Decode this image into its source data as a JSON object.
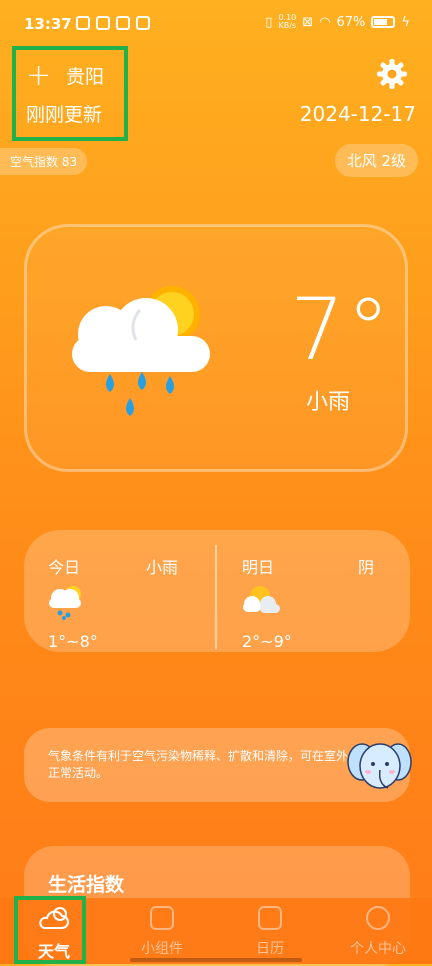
{
  "status_bar": {
    "time": "13:37",
    "net_speed": "0.10\nKB/s",
    "battery": "67%"
  },
  "header": {
    "add_symbol": "+",
    "city": "贵阳",
    "updated": "刚刚更新",
    "date": "2024-12-17"
  },
  "badges": {
    "aqi": "空气指数 83",
    "wind": "北风 2级"
  },
  "current": {
    "temperature": "7°",
    "condition": "小雨",
    "icon": "cloud-sun-rain-icon"
  },
  "forecast": [
    {
      "day": "今日",
      "condition": "小雨",
      "range": "1°~8°",
      "icon": "cloud-rain-icon"
    },
    {
      "day": "明日",
      "condition": "阴",
      "range": "2°~9°",
      "icon": "cloud-sun-icon"
    }
  ],
  "tip": {
    "text": "气象条件有利于空气污染物稀释、扩散和清除，可在室外正常活动。",
    "mascot": "elephant-mascot-icon"
  },
  "life": {
    "title": "生活指数"
  },
  "nav": {
    "items": [
      {
        "label": "天气",
        "icon": "weather-icon"
      },
      {
        "label": "小组件",
        "icon": "widget-icon"
      },
      {
        "label": "日历",
        "icon": "calendar-icon"
      },
      {
        "label": "个人中心",
        "icon": "profile-icon"
      }
    ]
  },
  "colors": {
    "accent_green": "#21b14a",
    "bg_top": "#ffb020",
    "bg_bottom": "#ff7b18"
  }
}
